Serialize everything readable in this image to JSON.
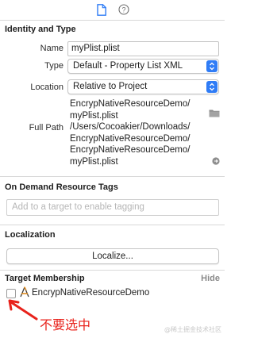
{
  "inspector_tabs": [
    {
      "icon": "file-inspector-icon",
      "selected": true
    },
    {
      "icon": "quick-help-icon",
      "selected": false
    }
  ],
  "identity": {
    "title": "Identity and Type",
    "name_label": "Name",
    "name_value": "myPlist.plist",
    "type_label": "Type",
    "type_value": "Default - Property List XML",
    "location_label": "Location",
    "location_value": "Relative to Project",
    "location_path_line1": "EncrypNativeResourceDemo/",
    "location_path_line2": "myPlist.plist",
    "fullpath_label": "Full Path",
    "fullpath_line1": "/Users/Cocoakier/Downloads/",
    "fullpath_line2": "EncrypNativeResourceDemo/",
    "fullpath_line3": "EncrypNativeResourceDemo/",
    "fullpath_line4": "myPlist.plist"
  },
  "on_demand": {
    "title": "On Demand Resource Tags",
    "placeholder": "Add to a target to enable tagging"
  },
  "localization": {
    "title": "Localization",
    "button_label": "Localize..."
  },
  "target_membership": {
    "title": "Target Membership",
    "hide_label": "Hide",
    "targets": [
      {
        "name": "EncrypNativeResourceDemo",
        "checked": false,
        "icon": "app-target-icon"
      }
    ]
  },
  "annotation": {
    "text": "不要选中",
    "color": "#e8221b"
  },
  "watermark": "@稀土掘金技术社区",
  "colors": {
    "accent": "#2f7cf6",
    "annotation_red": "#e8221b"
  }
}
